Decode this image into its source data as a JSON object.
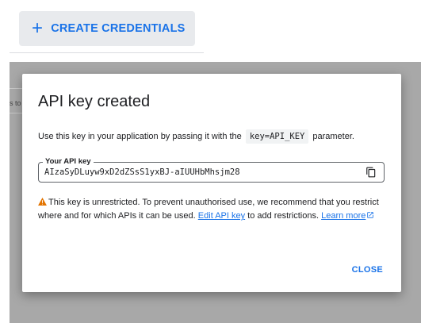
{
  "toolbar": {
    "create_label": "CREATE CREDENTIALS",
    "create_icon": "+"
  },
  "background": {
    "partial_text": "s to"
  },
  "dialog": {
    "title": "API key created",
    "desc_before": "Use this key in your application by passing it with the",
    "desc_code": "key=API_KEY",
    "desc_after": "parameter.",
    "key_label": "Your API key",
    "key_value": "AIzaSyDLuyw9xD2dZSsS1yxBJ-aIUUHbMhsjm28",
    "warning_text_1": "This key is unrestricted. To prevent unauthorised use, we recommend that you restrict where and for which APIs it can be used.",
    "edit_link": "Edit API key",
    "warning_text_2": "to add restrictions.",
    "learn_more": "Learn more",
    "close_label": "CLOSE"
  },
  "colors": {
    "accent": "#1a73e8",
    "warning": "#e37400",
    "scrim": "#a8a8a8"
  },
  "icons": [
    "plus-icon",
    "copy-icon",
    "warning-icon",
    "external-link-icon"
  ]
}
